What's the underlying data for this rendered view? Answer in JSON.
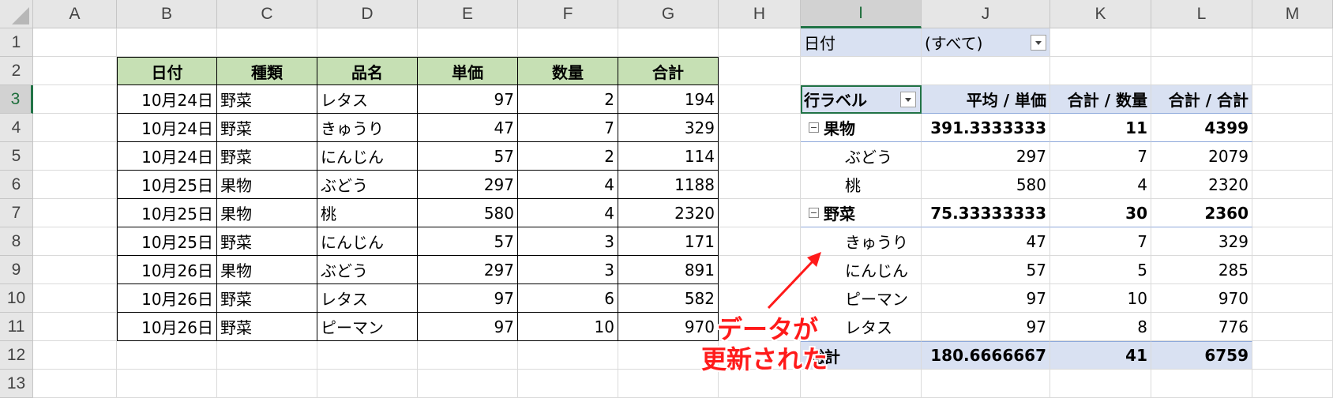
{
  "columns": [
    "A",
    "B",
    "C",
    "D",
    "E",
    "F",
    "G",
    "H",
    "I",
    "J",
    "K",
    "L",
    "M"
  ],
  "rows": [
    "1",
    "2",
    "3",
    "4",
    "5",
    "6",
    "7",
    "8",
    "9",
    "10",
    "11",
    "12",
    "13"
  ],
  "selected_column": "I",
  "selected_row": "3",
  "table": {
    "headers": [
      "日付",
      "種類",
      "品名",
      "単価",
      "数量",
      "合計"
    ],
    "rows": [
      [
        "10月24日",
        "野菜",
        "レタス",
        "97",
        "2",
        "194"
      ],
      [
        "10月24日",
        "野菜",
        "きゅうり",
        "47",
        "7",
        "329"
      ],
      [
        "10月24日",
        "野菜",
        "にんじん",
        "57",
        "2",
        "114"
      ],
      [
        "10月25日",
        "果物",
        "ぶどう",
        "297",
        "4",
        "1188"
      ],
      [
        "10月25日",
        "果物",
        "桃",
        "580",
        "4",
        "2320"
      ],
      [
        "10月25日",
        "野菜",
        "にんじん",
        "57",
        "3",
        "171"
      ],
      [
        "10月26日",
        "果物",
        "ぶどう",
        "297",
        "3",
        "891"
      ],
      [
        "10月26日",
        "野菜",
        "レタス",
        "97",
        "6",
        "582"
      ],
      [
        "10月26日",
        "野菜",
        "ピーマン",
        "97",
        "10",
        "970"
      ]
    ]
  },
  "pivot": {
    "filter_label": "日付",
    "filter_value": "(すべて)",
    "header": [
      "行ラベル",
      "平均 / 単価",
      "合計 / 数量",
      "合計 / 合計"
    ],
    "rows": [
      {
        "label": "果物",
        "values": [
          "391.3333333",
          "11",
          "4399"
        ],
        "group": true
      },
      {
        "label": "ぶどう",
        "values": [
          "297",
          "7",
          "2079"
        ],
        "group": false
      },
      {
        "label": "桃",
        "values": [
          "580",
          "4",
          "2320"
        ],
        "group": false
      },
      {
        "label": "野菜",
        "values": [
          "75.33333333",
          "30",
          "2360"
        ],
        "group": true
      },
      {
        "label": "きゅうり",
        "values": [
          "47",
          "7",
          "329"
        ],
        "group": false
      },
      {
        "label": "にんじん",
        "values": [
          "57",
          "5",
          "285"
        ],
        "group": false
      },
      {
        "label": "ピーマン",
        "values": [
          "97",
          "10",
          "970"
        ],
        "group": false
      },
      {
        "label": "レタス",
        "values": [
          "97",
          "8",
          "776"
        ],
        "group": false
      }
    ],
    "total_label": "総計",
    "total_values": [
      "180.6666667",
      "41",
      "6759"
    ]
  },
  "annotation": {
    "line1": "データが",
    "line2": "更新された",
    "color": "#ff1a1a"
  },
  "colors": {
    "table_header_bg": "#c6e0b4",
    "pivot_bg": "#d9e1f2",
    "selection": "#217346"
  }
}
